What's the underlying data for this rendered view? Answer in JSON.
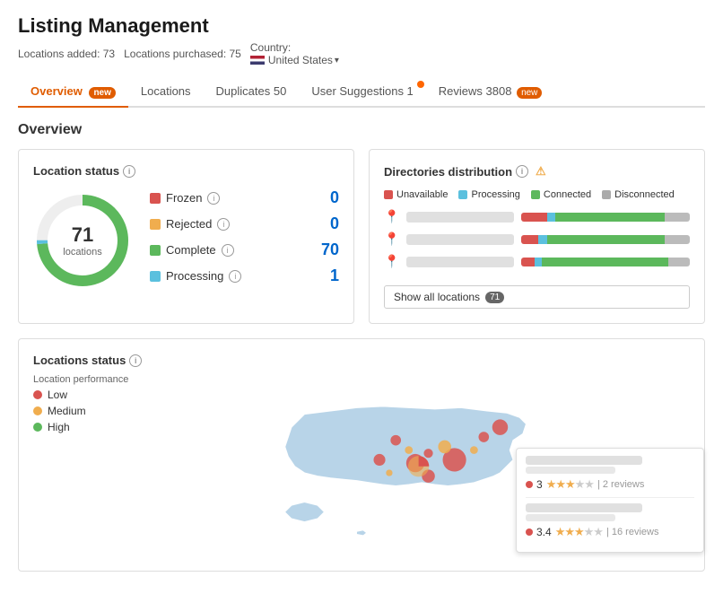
{
  "header": {
    "title": "Listing Management",
    "locations_added": "Locations added: 73",
    "locations_purchased": "Locations purchased: 75",
    "country_label": "Country:",
    "country_name": "United States"
  },
  "tabs": [
    {
      "id": "overview",
      "label": "Overview",
      "badge": "new",
      "active": true
    },
    {
      "id": "locations",
      "label": "Locations",
      "badge": null,
      "active": false
    },
    {
      "id": "duplicates",
      "label": "Duplicates 50",
      "badge": null,
      "active": false
    },
    {
      "id": "user-suggestions",
      "label": "User Suggestions 1",
      "badge": null,
      "dot": true,
      "active": false
    },
    {
      "id": "reviews",
      "label": "Reviews 3808",
      "badge": "new",
      "active": false
    }
  ],
  "overview_title": "Overview",
  "location_status": {
    "title": "Location status",
    "total": "71",
    "total_label": "locations",
    "items": [
      {
        "id": "frozen",
        "label": "Frozen",
        "count": "0",
        "color": "frozen"
      },
      {
        "id": "rejected",
        "label": "Rejected",
        "count": "0",
        "color": "rejected"
      },
      {
        "id": "complete",
        "label": "Complete",
        "count": "70",
        "color": "complete"
      },
      {
        "id": "processing",
        "label": "Processing",
        "count": "1",
        "color": "processing"
      }
    ]
  },
  "directories": {
    "title": "Directories distribution",
    "legend": [
      {
        "id": "unavailable",
        "label": "Unavailable"
      },
      {
        "id": "processing",
        "label": "Processing"
      },
      {
        "id": "connected",
        "label": "Connected"
      },
      {
        "id": "disconnected",
        "label": "Disconnected"
      }
    ],
    "rows": [
      {
        "bars": [
          {
            "type": "red",
            "pct": 15
          },
          {
            "type": "blue",
            "pct": 5
          },
          {
            "type": "green",
            "pct": 65
          },
          {
            "type": "gray",
            "pct": 15
          }
        ]
      },
      {
        "bars": [
          {
            "type": "red",
            "pct": 10
          },
          {
            "type": "blue",
            "pct": 5
          },
          {
            "type": "green",
            "pct": 70
          },
          {
            "type": "gray",
            "pct": 15
          }
        ]
      },
      {
        "bars": [
          {
            "type": "red",
            "pct": 8
          },
          {
            "type": "blue",
            "pct": 4
          },
          {
            "type": "green",
            "pct": 75
          },
          {
            "type": "gray",
            "pct": 13
          }
        ]
      }
    ],
    "show_all_label": "Show all locations",
    "show_all_count": "71"
  },
  "locations_status": {
    "title": "Locations status",
    "performance_label": "Location performance",
    "legend": [
      {
        "id": "low",
        "label": "Low"
      },
      {
        "id": "medium",
        "label": "Medium"
      },
      {
        "id": "high",
        "label": "High"
      }
    ]
  },
  "popup": {
    "items": [
      {
        "rating": "3",
        "stars": 3,
        "reviews": "2 reviews"
      },
      {
        "rating": "3.4",
        "stars": 3,
        "reviews": "16 reviews"
      }
    ]
  }
}
